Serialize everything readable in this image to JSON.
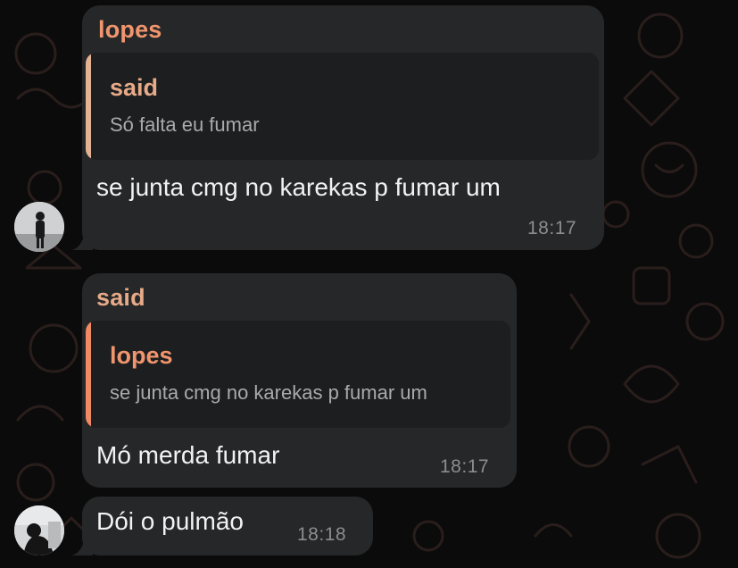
{
  "colors": {
    "background": "#0b0b0b",
    "bubble": "#262728",
    "quote_background": "#1d1e1f",
    "name_lopes": "#f0956e",
    "name_said": "#e6aa88",
    "bar_lopes": "#ef8a63",
    "bar_said": "#e3b393",
    "text": "#f2f2f2",
    "muted": "#8c8d8e"
  },
  "messages": [
    {
      "sender": "lopes",
      "quote": {
        "name": "said",
        "text": "Só falta eu fumar"
      },
      "text": "se junta cmg no karekas p fumar um",
      "time": "18:17"
    },
    {
      "sender": "said",
      "quote": {
        "name": "lopes",
        "text": "se junta cmg no karekas p fumar um"
      },
      "text": "Mó merda fumar",
      "time": "18:17"
    },
    {
      "text": "Dói o pulmão",
      "time": "18:18"
    }
  ]
}
